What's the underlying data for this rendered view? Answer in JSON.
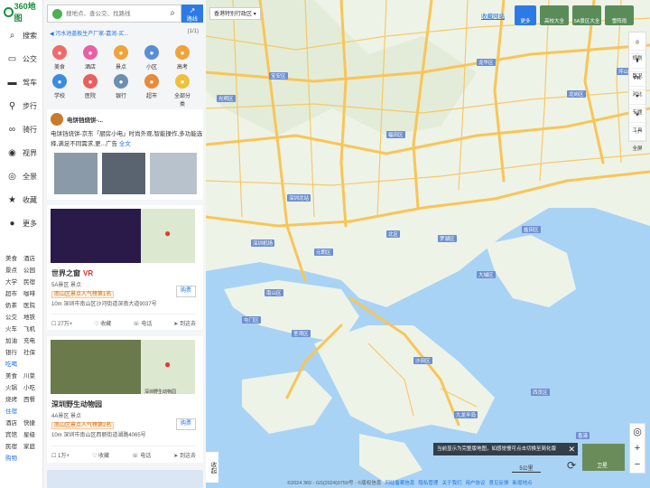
{
  "logo": {
    "text": "360地图"
  },
  "nav": [
    {
      "label": "搜索",
      "icon": "search-icon"
    },
    {
      "label": "公交",
      "icon": "bus-icon"
    },
    {
      "label": "驾车",
      "icon": "car-icon"
    },
    {
      "label": "步行",
      "icon": "walk-icon"
    },
    {
      "label": "骑行",
      "icon": "bike-icon"
    },
    {
      "label": "视界",
      "icon": "eye-icon"
    },
    {
      "label": "全景",
      "icon": "panorama-icon"
    },
    {
      "label": "收藏",
      "icon": "star-icon"
    },
    {
      "label": "更多",
      "icon": "more-icon"
    }
  ],
  "categories": [
    [
      "美食",
      "酒店"
    ],
    [
      "景点",
      "公园"
    ],
    [
      "大学",
      "民宿"
    ],
    [
      "超市",
      "咖啡"
    ],
    [
      "奶茶",
      "医院"
    ],
    [
      "公交",
      "地铁"
    ],
    [
      "火车",
      "飞机"
    ],
    [
      "加油",
      "充电"
    ],
    [
      "银行",
      "社保"
    ]
  ],
  "eat_section": {
    "title": "吃喝",
    "items": [
      [
        "美食",
        "川菜"
      ],
      [
        "火锅",
        "小吃"
      ],
      [
        "烧烤",
        "西餐"
      ]
    ]
  },
  "stay_section": {
    "title": "住宿",
    "items": [
      [
        "酒店",
        "快捷"
      ],
      [
        "宾馆",
        "星级"
      ],
      [
        "民宿",
        "家庭"
      ]
    ]
  },
  "shop_section": {
    "title": "购物"
  },
  "search": {
    "placeholder": "搜地点、查公交、找路线",
    "route_label": "路线"
  },
  "notice": {
    "text": "污水池盖板生产厂家-嘉润-买...",
    "page": "(1/1)"
  },
  "grid": [
    {
      "label": "美食",
      "color": "#f06a6a"
    },
    {
      "label": "酒店",
      "color": "#e95fa3"
    },
    {
      "label": "景点",
      "color": "#f0a33a"
    },
    {
      "label": "小区",
      "color": "#5b8cd6"
    },
    {
      "label": "高考",
      "color": "#f0a33a"
    },
    {
      "label": "学校",
      "color": "#3b8be0"
    },
    {
      "label": "医院",
      "color": "#e95f5f"
    },
    {
      "label": "银行",
      "color": "#6b8fb0"
    },
    {
      "label": "超市",
      "color": "#e88a3a"
    },
    {
      "label": "全部分类",
      "color": "#f0c03a"
    }
  ],
  "ad": {
    "name": "电饼铛烧饼-...",
    "text": "电饼铛烧饼-京东「厨房小电」时尚外观,智能操作,多功能选择,满足不同需求,更...广告",
    "more": "全文"
  },
  "poi1": {
    "title": "世界之窗",
    "vr": "VR",
    "level": "5A景区  景点",
    "rank": "南山区景点人气榜第1名",
    "addr": "10m  深圳市南山区沙河街道深南大道9037号",
    "buy": "购票",
    "acts": [
      "27万+",
      "收藏",
      "电话",
      "到这去"
    ]
  },
  "poi2": {
    "title": "深圳野生动物园",
    "level": "4A景区  景点",
    "rank": "南山区景点人气榜第2名",
    "addr": "10m  深圳市南山区西丽街道湖路4065号",
    "buy": "购票",
    "acts": [
      "1万+",
      "收藏",
      "电话",
      "到这去"
    ],
    "map_label": "深圳野生动物园"
  },
  "collapse": "收起",
  "map": {
    "region_label": "香港特别行政区",
    "favorite": "收藏网站",
    "top_buttons": [
      "更多",
      "高校大全",
      "5A景区大全",
      "雪阵雨"
    ],
    "tools": [
      "规划",
      "路况",
      "对比",
      "专题",
      "工具",
      "全屏"
    ],
    "tools_top": [
      "",
      "",
      "PK",
      "",
      "",
      ""
    ],
    "banner": "当前显示为完整版地图，如感觉慢可点击切换至简化版",
    "sat_label": "卫星",
    "scale": "5公里",
    "district_labels": [
      "龙华区",
      "光明区",
      "宝安区",
      "龙岗区",
      "南山区",
      "福田区",
      "罗湖区",
      "盐田区",
      "坪山区",
      "深圳北站",
      "深圳机场",
      "香港",
      "九龙半岛",
      "元朗区",
      "屯门区",
      "荃湾区",
      "北区",
      "大埔区",
      "沙田区",
      "西贡区"
    ],
    "footer": "©2024 360 - GS(2024)0759号 - ©版权信息",
    "footer_links": [
      "网站备案信息",
      "隐私管理",
      "关于我们",
      "用户协议",
      "意见反馈",
      "新增地点"
    ]
  },
  "colors": {
    "accent": "#2d7ae6",
    "brand": "#1a8f3c",
    "road": "#f9c557",
    "water": "#a8d3f5",
    "land": "#eef3e8"
  }
}
